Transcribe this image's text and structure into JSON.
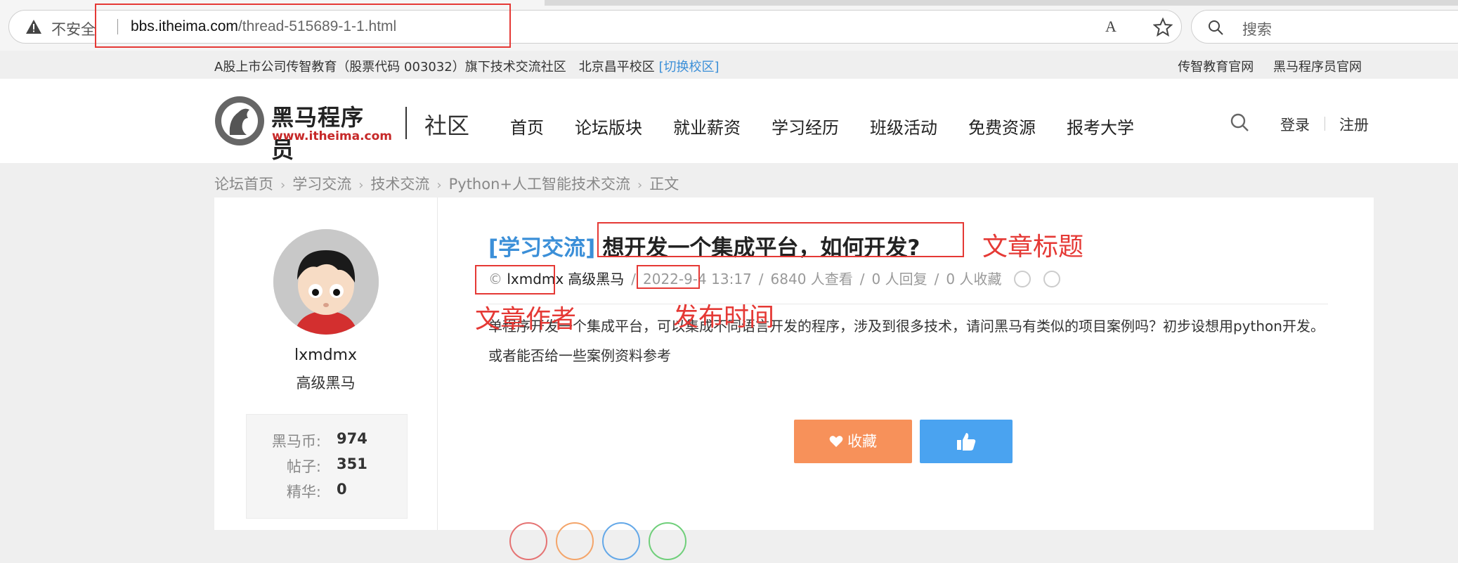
{
  "browser": {
    "security_label": "不安全",
    "url_host": "bbs.itheima.com",
    "url_path": "/thread-515689-1-1.html",
    "search_placeholder": "搜索",
    "read_aloud_glyph": "A"
  },
  "topbar": {
    "left_text": "A股上市公司传智教育（股票代码 003032）旗下技术交流社区　北京昌平校区",
    "switch_campus": "[切换校区]",
    "links": [
      "传智教育官网",
      "黑马程序员官网"
    ]
  },
  "header": {
    "logo_title": "黑马程序员",
    "logo_site": "www.itheima.com",
    "community_label": "社区",
    "nav": [
      "首页",
      "论坛版块",
      "就业薪资",
      "学习经历",
      "班级活动",
      "免费资源",
      "报考大学"
    ],
    "login": "登录",
    "register": "注册"
  },
  "breadcrumb": [
    "论坛首页",
    "学习交流",
    "技术交流",
    "Python+人工智能技术交流",
    "正文"
  ],
  "sidebar": {
    "username": "lxmdmx",
    "rank": "高级黑马",
    "stats": [
      {
        "label": "黑马币:",
        "value": "974"
      },
      {
        "label": "帖子:",
        "value": "351"
      },
      {
        "label": "精华:",
        "value": "0"
      }
    ]
  },
  "post": {
    "category": "[学习交流]",
    "title": "想开发一个集成平台，如何开发?",
    "author_prefix": "©",
    "author": "lxmdmx",
    "author_rank": "高级黑马",
    "date": "2022-9-4",
    "time": "13:17",
    "views": "6840 人查看",
    "replies": "0 人回复",
    "favorites": "0 人收藏",
    "body": "单程序开发一个集成平台，可以集成不同语言开发的程序，涉及到很多技术，请问黑马有类似的项目案例吗？初步设想用python开发。或者能否给一些案例资料参考",
    "fav_button": "收藏"
  },
  "annotations": {
    "title_label": "文章标题",
    "author_label": "文章作者",
    "time_label": "发布时间",
    "color": "#e53935"
  }
}
